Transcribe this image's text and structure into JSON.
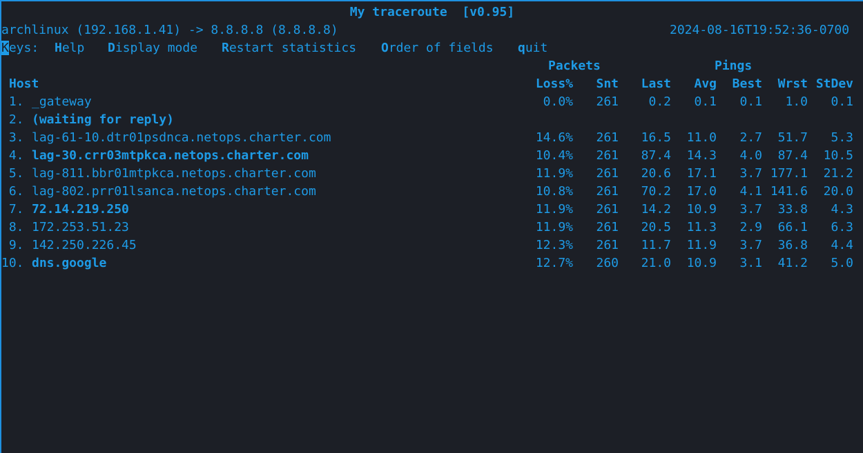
{
  "title": "My traceroute  [v0.95]",
  "source_host": "archlinux (192.168.1.41) -> 8.8.8.8 (8.8.8.8)",
  "timestamp": "2024-08-16T19:52:36-0700",
  "keys": {
    "prefix_cursor": "K",
    "prefix_rest": "eys:",
    "items": [
      {
        "key": "H",
        "rest": "elp"
      },
      {
        "key": "D",
        "rest": "isplay mode"
      },
      {
        "key": "R",
        "rest": "estart statistics"
      },
      {
        "key": "O",
        "rest": "rder of fields"
      },
      {
        "key": "q",
        "rest": "uit"
      }
    ]
  },
  "group_headers": {
    "packets": "Packets",
    "pings": "Pings"
  },
  "columns": {
    "host": "Host",
    "loss": "Loss%",
    "snt": "Snt",
    "last": "Last",
    "avg": "Avg",
    "best": "Best",
    "wrst": "Wrst",
    "stdev": "StDev"
  },
  "hops": [
    {
      "num": " 1.",
      "host": "_gateway",
      "bold": false,
      "loss": "0.0%",
      "snt": "261",
      "last": "0.2",
      "avg": "0.1",
      "best": "0.1",
      "wrst": "1.0",
      "stdev": "0.1"
    },
    {
      "num": " 2.",
      "host": "(waiting for reply)",
      "bold": true,
      "loss": "",
      "snt": "",
      "last": "",
      "avg": "",
      "best": "",
      "wrst": "",
      "stdev": ""
    },
    {
      "num": " 3.",
      "host": "lag-61-10.dtr01psdnca.netops.charter.com",
      "bold": false,
      "loss": "14.6%",
      "snt": "261",
      "last": "16.5",
      "avg": "11.0",
      "best": "2.7",
      "wrst": "51.7",
      "stdev": "5.3"
    },
    {
      "num": " 4.",
      "host": "lag-30.crr03mtpkca.netops.charter.com",
      "bold": true,
      "loss": "10.4%",
      "snt": "261",
      "last": "87.4",
      "avg": "14.3",
      "best": "4.0",
      "wrst": "87.4",
      "stdev": "10.5"
    },
    {
      "num": " 5.",
      "host": "lag-811.bbr01mtpkca.netops.charter.com",
      "bold": false,
      "loss": "11.9%",
      "snt": "261",
      "last": "20.6",
      "avg": "17.1",
      "best": "3.7",
      "wrst": "177.1",
      "stdev": "21.2"
    },
    {
      "num": " 6.",
      "host": "lag-802.prr01lsanca.netops.charter.com",
      "bold": false,
      "loss": "10.8%",
      "snt": "261",
      "last": "70.2",
      "avg": "17.0",
      "best": "4.1",
      "wrst": "141.6",
      "stdev": "20.0"
    },
    {
      "num": " 7.",
      "host": "72.14.219.250",
      "bold": true,
      "loss": "11.9%",
      "snt": "261",
      "last": "14.2",
      "avg": "10.9",
      "best": "3.7",
      "wrst": "33.8",
      "stdev": "4.3"
    },
    {
      "num": " 8.",
      "host": "172.253.51.23",
      "bold": false,
      "loss": "11.9%",
      "snt": "261",
      "last": "20.5",
      "avg": "11.3",
      "best": "2.9",
      "wrst": "66.1",
      "stdev": "6.3"
    },
    {
      "num": " 9.",
      "host": "142.250.226.45",
      "bold": false,
      "loss": "12.3%",
      "snt": "261",
      "last": "11.7",
      "avg": "11.9",
      "best": "3.7",
      "wrst": "36.8",
      "stdev": "4.4"
    },
    {
      "num": "10.",
      "host": "dns.google",
      "bold": true,
      "loss": "12.7%",
      "snt": "260",
      "last": "21.0",
      "avg": "10.9",
      "best": "3.1",
      "wrst": "41.2",
      "stdev": "5.0"
    }
  ],
  "colors": {
    "background": "#1c1f26",
    "foreground": "#1e9be6",
    "border": "#1e90e0"
  }
}
